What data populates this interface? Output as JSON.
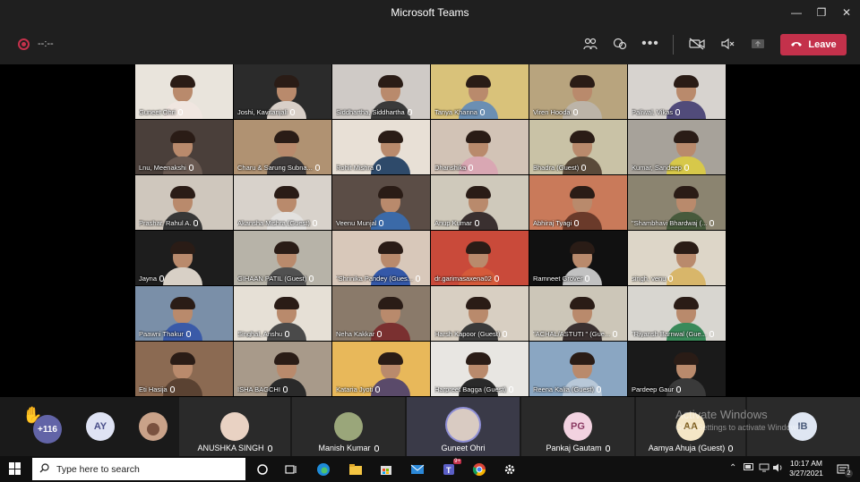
{
  "window": {
    "title": "Microsoft Teams",
    "minimize_icon": "minimize-icon",
    "maximize_icon": "maximize-icon",
    "close_icon": "close-icon"
  },
  "meeting_bar": {
    "timer": "--:--",
    "leave_label": "Leave",
    "icons": [
      "participants-icon",
      "breakout-rooms-icon",
      "more-options-icon",
      "camera-off-icon",
      "mic-off-icon",
      "share-screen-icon"
    ],
    "leave_color": "#c4314b"
  },
  "video_grid": {
    "tiles": [
      {
        "name": "Guneet Ohri",
        "bg": "#e9e4dc",
        "shirt": "#f0e6e0"
      },
      {
        "name": "Joshi, Kavitanjali",
        "bg": "#2b2b2b",
        "shirt": "#d8cfc8"
      },
      {
        "name": "Siddhartha, Siddhartha",
        "bg": "#cfcac6",
        "shirt": "#3a3a3a"
      },
      {
        "name": "Tanya Khanna",
        "bg": "#d9c27a",
        "shirt": "#6b8fb3"
      },
      {
        "name": "Viren Hooda",
        "bg": "#b8a47e",
        "shirt": "#bcb4a8"
      },
      {
        "name": "Paliwal, Vikas",
        "bg": "#d7d3cf",
        "shirt": "#514b7a"
      },
      {
        "name": "Lnu, Meenakshi",
        "bg": "#4a3f3a",
        "shirt": "#6a5a52"
      },
      {
        "name": "Charu & Sarung Subna...",
        "bg": "#b09272",
        "shirt": "#3e3a3a"
      },
      {
        "name": "Rohit Mishra",
        "bg": "#e8e0d6",
        "shirt": "#2e4a6a"
      },
      {
        "name": "Dhanshika",
        "bg": "#d2c3b6",
        "shirt": "#d9a7b3"
      },
      {
        "name": "Bhadra (Guest)",
        "bg": "#c9c2a6",
        "shirt": "#5a4a3a"
      },
      {
        "name": "Kumar, Sandeep",
        "bg": "#a7a29a",
        "shirt": "#d7c84a"
      },
      {
        "name": "Prashar, Rahul A.",
        "bg": "#cfc7bd",
        "shirt": "#373737"
      },
      {
        "name": "Akansha Mishra (Guest)",
        "bg": "#d8d2cb",
        "shirt": "#e3e1df"
      },
      {
        "name": "Veenu Munjal",
        "bg": "#5b4d46",
        "shirt": "#3b6aa8"
      },
      {
        "name": "Anup Kumar",
        "bg": "#cfc9bb",
        "shirt": "#3a3030"
      },
      {
        "name": "Abhiraj Tyagi",
        "bg": "#c97a5a",
        "shirt": "#6a3a2a"
      },
      {
        "name": "\"Shambhavi Bhardwaj (...",
        "bg": "#8b8470",
        "shirt": "#475a3c"
      },
      {
        "name": "Jayna",
        "bg": "#1d1d1d",
        "shirt": "#d8d0c6"
      },
      {
        "name": "GIHAAN PATIL (Guest)",
        "bg": "#b7b3a8",
        "shirt": "#505050"
      },
      {
        "name": "\"Shrinika Pandey (Gues...",
        "bg": "#d8c8ba",
        "shirt": "#3458a8"
      },
      {
        "name": "dr.garimasaxena02",
        "bg": "#c94a3a",
        "shirt": "#d55a3a"
      },
      {
        "name": "Ramneet Grover",
        "bg": "#111111",
        "shirt": "#c2c2c2"
      },
      {
        "name": "singh, venu",
        "bg": "#ddd6c8",
        "shirt": "#d8b66a"
      },
      {
        "name": "Paawni Thakur",
        "bg": "#7a8fa8",
        "shirt": "#3a5aa8"
      },
      {
        "name": "Singhal, Anshu",
        "bg": "#e6e0d6",
        "shirt": "#4a4a4a"
      },
      {
        "name": "Neha Kakkar",
        "bg": "#8a7a6a",
        "shirt": "#7a3030"
      },
      {
        "name": "Harsh Kapoor (Guest)",
        "bg": "#d8cfc2",
        "shirt": "#3a3a3a"
      },
      {
        "name": "\"ACHAL/ASTUTI \" (Gue...",
        "bg": "#ccc6b8",
        "shirt": "#3a3030"
      },
      {
        "name": "\"Riyansh Barnwal (Gue...",
        "bg": "#d8d6d0",
        "shirt": "#3a8a5a"
      },
      {
        "name": "Eti Hasija",
        "bg": "#8b6a52",
        "shirt": "#5a4232"
      },
      {
        "name": "ISHA BAGCHI",
        "bg": "#a89a8a",
        "shirt": "#2a2a2a"
      },
      {
        "name": "Kataria Jyoti",
        "bg": "#e8b85a",
        "shirt": "#5a4a6a"
      },
      {
        "name": "Harpreet Bagga (Guest)",
        "bg": "#e8e6e2",
        "shirt": "#2a2a2a"
      },
      {
        "name": "Reena Kalia (Guest)",
        "bg": "#8aa6c2",
        "shirt": "#b8c8d8"
      },
      {
        "name": "Pardeep Gaur",
        "bg": "#1a1a1a",
        "shirt": "#3a3a3a"
      }
    ]
  },
  "participant_strip": {
    "overflow_count": "+116",
    "hand_icon": "raised-hand-icon",
    "avatars": [
      {
        "initials": "AY",
        "name": ""
      },
      {
        "initials": "",
        "name": ""
      }
    ],
    "named": [
      {
        "name": "ANUSHKA SINGH"
      },
      {
        "name": "Manish Kumar"
      },
      {
        "name": "Guneet Ohri"
      },
      {
        "name": "Pankaj Gautam",
        "initials": "PG"
      },
      {
        "name": "Aamya Ahuja (Guest)",
        "initials": "AA"
      },
      {
        "name": "",
        "initials": "IB"
      }
    ]
  },
  "watermark": {
    "line1": "Activate Windows",
    "line2": "Go to Settings to activate Windows."
  },
  "taskbar": {
    "search_placeholder": "Type here to search",
    "teams_badge": "9+",
    "notification_count": "2",
    "time": "10:17 AM",
    "date": "3/27/2021",
    "apps": [
      "cortana-icon",
      "task-view-icon",
      "edge-icon",
      "file-explorer-icon",
      "store-icon",
      "mail-icon",
      "teams-icon",
      "chrome-icon",
      "settings-icon"
    ]
  }
}
